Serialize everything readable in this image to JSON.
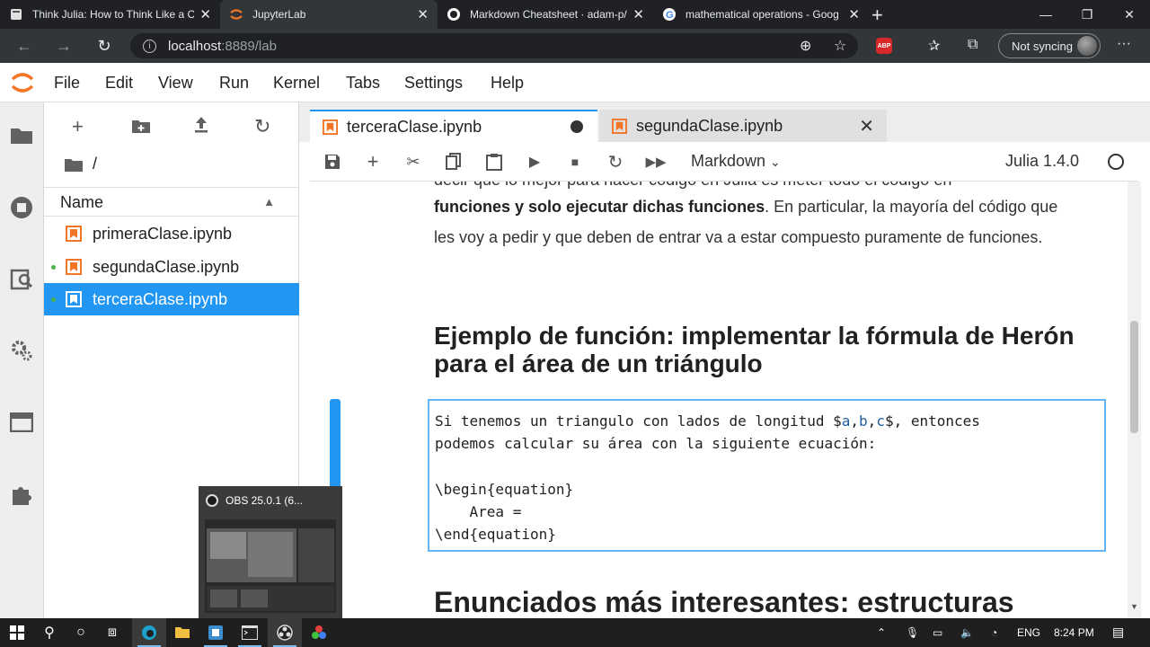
{
  "browser": {
    "tabs": [
      {
        "title": "Think Julia: How to Think Like a C",
        "icon": "book-icon"
      },
      {
        "title": "JupyterLab",
        "icon": "jupyter-icon",
        "active": true
      },
      {
        "title": "Markdown Cheatsheet · adam-p/",
        "icon": "github-icon"
      },
      {
        "title": "mathematical operations - Goog",
        "icon": "google-icon"
      }
    ],
    "url_host": "localhost",
    "url_path": ":8889/lab",
    "sync_label": "Not syncing",
    "abp_label": "ABP"
  },
  "menu": [
    "File",
    "Edit",
    "View",
    "Run",
    "Kernel",
    "Tabs",
    "Settings",
    "Help"
  ],
  "filebrowser": {
    "path": "/",
    "column_header": "Name",
    "files": [
      {
        "name": "primeraClase.ipynb",
        "running": false,
        "selected": false
      },
      {
        "name": "segundaClase.ipynb",
        "running": true,
        "selected": false
      },
      {
        "name": "terceraClase.ipynb",
        "running": true,
        "selected": true
      }
    ]
  },
  "notebook": {
    "tabs": [
      {
        "title": "terceraClase.ipynb",
        "active": true,
        "dirty": true
      },
      {
        "title": "segundaClase.ipynb",
        "active": false,
        "dirty": false
      }
    ],
    "cell_type": "Markdown",
    "kernel": "Julia 1.4.0",
    "para_top": "decir que lo mejor para hacer código en Julia es meter todo el código en",
    "para_bold": "funciones y solo ejecutar dichas funciones",
    "para_rest": ". En particular, la mayoría del código que les voy a pedir y que deben de entrar va a estar compuesto puramente de funciones.",
    "heading": "Ejemplo de función: implementar la fórmula de Herón para el área de un triángulo",
    "editor_lines": [
      "Si tenemos un triangulo con lados de longitud $a,b,c$, entonces",
      "podemos calcular su área con la siguiente ecuación:",
      "",
      "\\begin{equation}",
      "    Area =",
      "\\end{equation}"
    ],
    "next_heading": "Enunciados más interesantes: estructuras"
  },
  "obs_preview": {
    "title": "OBS 25.0.1 (6..."
  },
  "taskbar": {
    "lang": "ENG",
    "time": "8:24 PM"
  },
  "colors": {
    "accent": "#2196f3",
    "jupyter_orange": "#f37626",
    "browser_dark": "#202124"
  }
}
